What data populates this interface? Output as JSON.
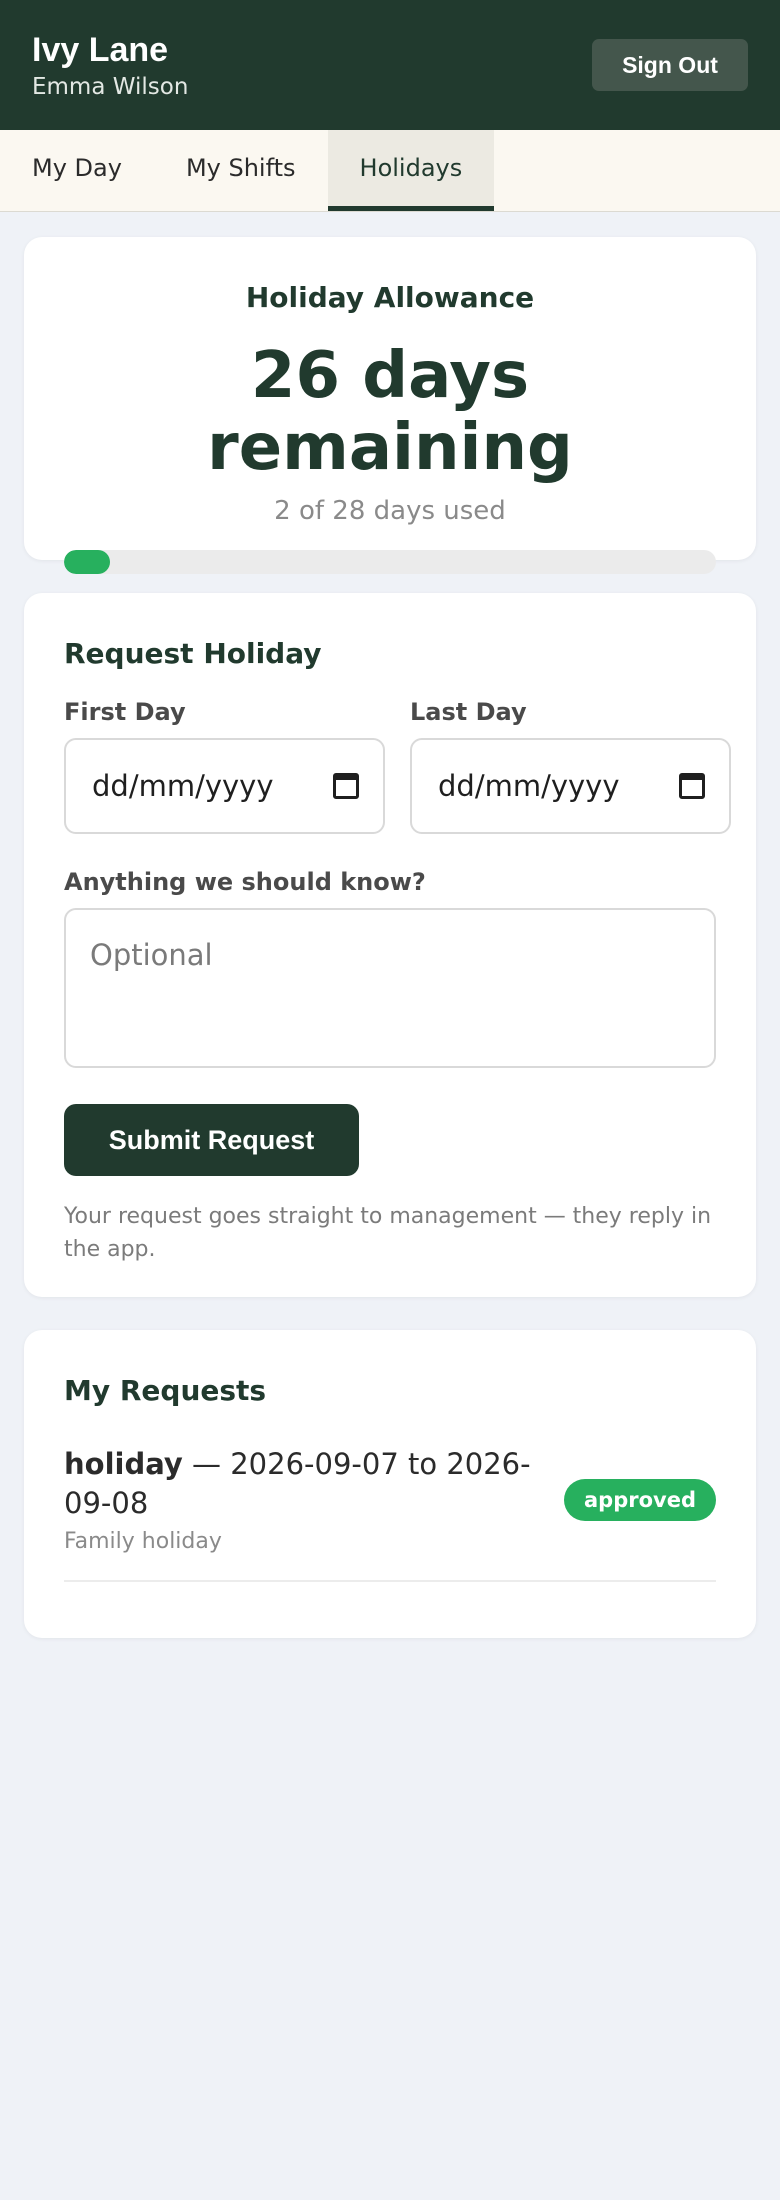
{
  "header": {
    "title": "Ivy Lane",
    "user_name": "Emma Wilson",
    "signout_label": "Sign Out"
  },
  "tabs": [
    {
      "label": "My Day",
      "active": false
    },
    {
      "label": "My Shifts",
      "active": false
    },
    {
      "label": "Holidays",
      "active": true
    }
  ],
  "allowance": {
    "title": "Holiday Allowance",
    "remaining_text": "26 days remaining",
    "used_text": "2 of 28 days used",
    "used_days": 2,
    "total_days": 28,
    "progress_fraction": 0.07
  },
  "request_form": {
    "title": "Request Holiday",
    "first_day_label": "First Day",
    "first_day_value": "dd/mm/yyyy",
    "last_day_label": "Last Day",
    "last_day_value": "dd/mm/yyyy",
    "notes_label": "Anything we should know?",
    "notes_placeholder": "Optional",
    "submit_label": "Submit Request",
    "helper_text": "Your request goes straight to management — they reply in the app."
  },
  "requests": {
    "title": "My Requests",
    "items": [
      {
        "type": "holiday",
        "range": " — 2026-09-07 to 2026-09-08",
        "note": "Family holiday",
        "status": "approved"
      }
    ]
  },
  "colors": {
    "header_bg": "#213a2e",
    "accent_green": "#27b05e",
    "page_bg": "#eff2f7"
  },
  "icons": {
    "date_picker": "calendar-icon"
  }
}
